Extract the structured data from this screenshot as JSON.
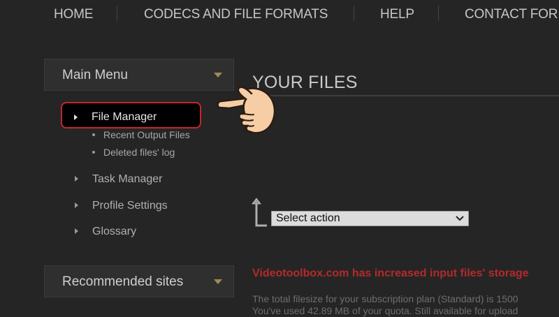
{
  "nav": {
    "items": [
      "HOME",
      "CODECS AND FILE FORMATS",
      "HELP",
      "CONTACT FOR"
    ]
  },
  "sidebar": {
    "main_menu_title": "Main Menu",
    "file_manager_label": "File Manager",
    "sub_items": [
      "Recent Output Files",
      "Deleted files' log"
    ],
    "items": [
      "Task Manager",
      "Profile Settings",
      "Glossary"
    ],
    "recommended_title": "Recommended sites"
  },
  "main": {
    "title": "YOUR FILES",
    "select_action_label": "Select action",
    "notice": "Videotoolbox.com has increased input files' storage",
    "info_line1": "The total filesize for your subscription plan (Standard) is 1500",
    "info_line2": "You've used 42.89 MB of your quota. Still available for upload"
  },
  "colors": {
    "background": "#252525",
    "highlight_border": "#c1272d",
    "notice_red": "#b42a2a",
    "dropdown_arrow": "#a38a52"
  },
  "icons": [
    "chevron-down-icon",
    "pointer-hand-icon",
    "up-arrow-icon",
    "caret-right-icon"
  ]
}
